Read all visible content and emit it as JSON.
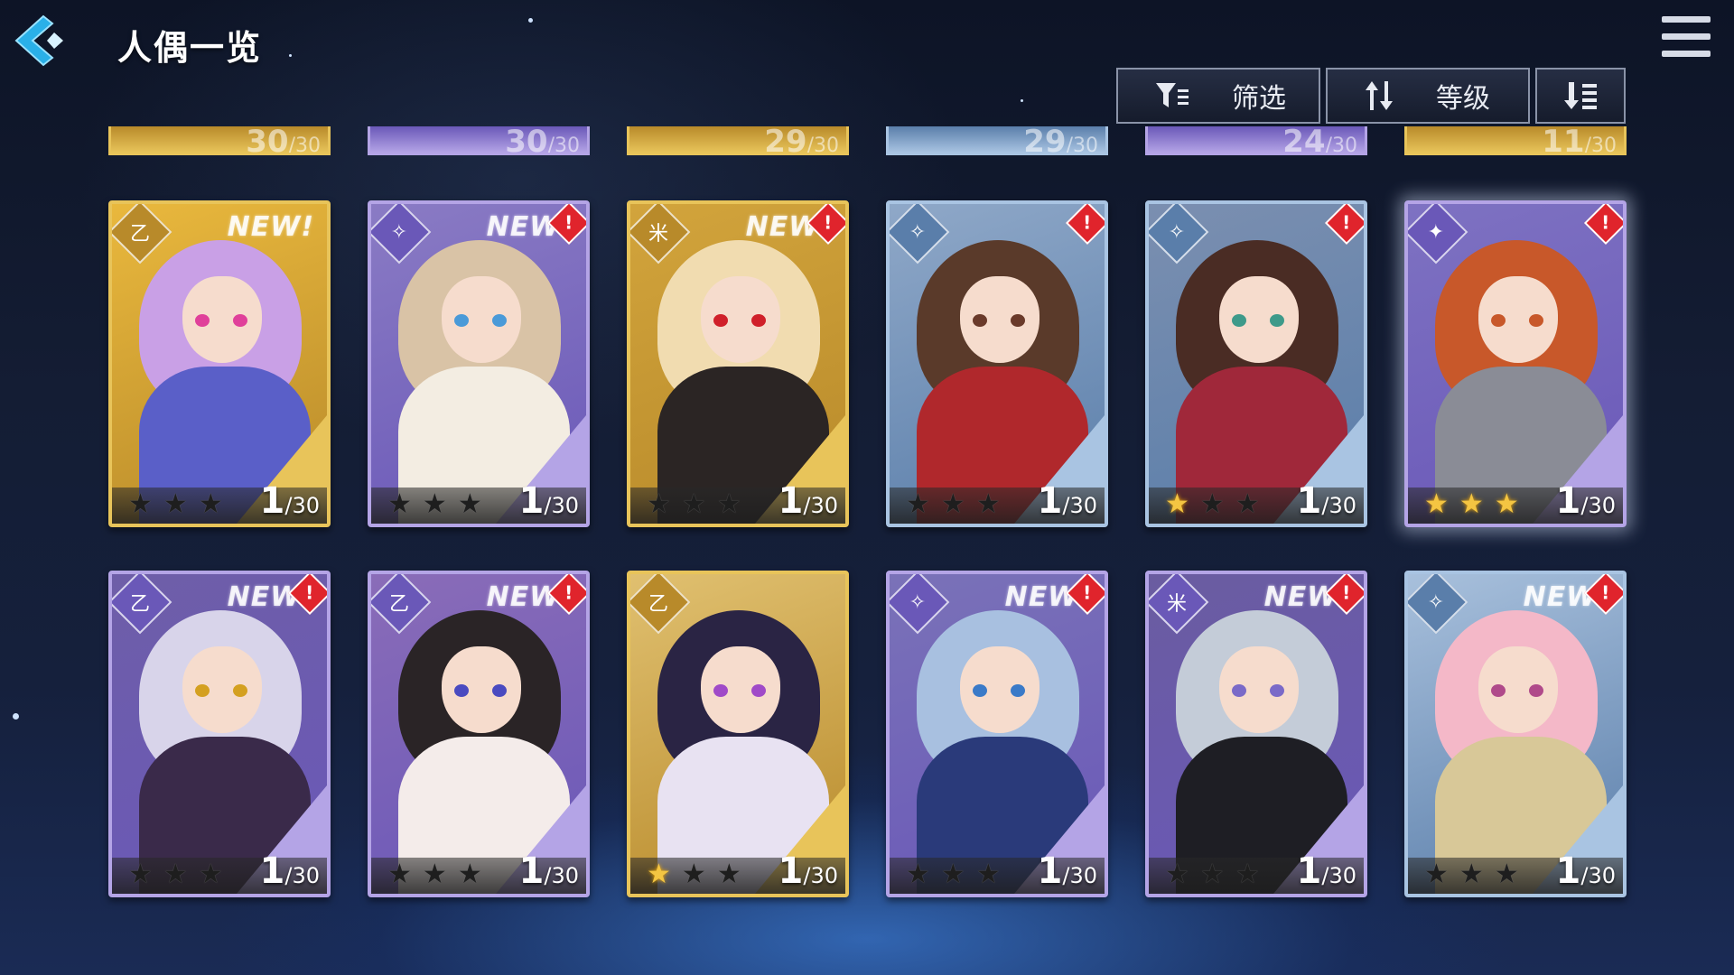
{
  "header": {
    "title": "人偶一览",
    "back_icon": "back-chevron-icon",
    "menu_icon": "hamburger-menu-icon"
  },
  "toolbar": {
    "filter_label": "筛选",
    "filter_icon": "filter-icon",
    "sort_label": "等级",
    "sort_icon": "sort-arrows-icon",
    "order_icon": "sort-order-icon"
  },
  "partial_row": [
    {
      "level": "30",
      "max": "/30",
      "frame": "gold"
    },
    {
      "level": "30",
      "max": "/30",
      "frame": "purple"
    },
    {
      "level": "29",
      "max": "/30",
      "frame": "gold"
    },
    {
      "level": "29",
      "max": "/30",
      "frame": "blue"
    },
    {
      "level": "24",
      "max": "/30",
      "frame": "purple"
    },
    {
      "level": "11",
      "max": "/30",
      "frame": "gold"
    }
  ],
  "cards": [
    {
      "frame": "gold",
      "attribute": "乙",
      "new": "NEW!",
      "alert": "",
      "stars_lit": 0,
      "level": "1",
      "max": "/30",
      "hair": "#c9a0e6",
      "outfit": "#5a5fc8",
      "eyes": "#e0409a",
      "bg": "#e9b83d"
    },
    {
      "frame": "purple",
      "attribute": "✧",
      "new": "NEW!",
      "alert": "!",
      "stars_lit": 0,
      "level": "1",
      "max": "/30",
      "hair": "#d9c3a6",
      "outfit": "#f3ede2",
      "eyes": "#4a9ad8",
      "bg": "#8a7bc4"
    },
    {
      "frame": "gold",
      "attribute": "米",
      "new": "NEW!",
      "alert": "!",
      "stars_lit": 0,
      "level": "1",
      "max": "/30",
      "hair": "#f1dcb0",
      "outfit": "#2b2524",
      "eyes": "#d0202a",
      "bg": "#d2a43c"
    },
    {
      "frame": "blue",
      "attribute": "✧",
      "new": "",
      "alert": "!",
      "stars_lit": 0,
      "level": "1",
      "max": "/30",
      "hair": "#5a3a2a",
      "outfit": "#b0282c",
      "eyes": "#6a3a2a",
      "bg": "#8fa8c8"
    },
    {
      "frame": "blue",
      "attribute": "✧",
      "new": "",
      "alert": "!",
      "stars_lit": 1,
      "level": "1",
      "max": "/30",
      "hair": "#4a2c24",
      "outfit": "#a0283a",
      "eyes": "#3e9a8a",
      "bg": "#7b8fb0"
    },
    {
      "frame": "purple",
      "attribute": "✦",
      "new": "",
      "alert": "!",
      "stars_lit": 3,
      "level": "1",
      "max": "/30",
      "hair": "#c8582a",
      "outfit": "#8a8c96",
      "eyes": "#c8582a",
      "bg": "#7e72c2"
    },
    {
      "frame": "purple",
      "attribute": "乙",
      "new": "NEW!",
      "alert": "!",
      "stars_lit": 0,
      "level": "1",
      "max": "/30",
      "hair": "#d8d4ea",
      "outfit": "#3a2a4a",
      "eyes": "#d4a020",
      "bg": "#6e5ea8"
    },
    {
      "frame": "purple",
      "attribute": "乙",
      "new": "NEW!",
      "alert": "!",
      "stars_lit": 0,
      "level": "1",
      "max": "/30",
      "hair": "#2a2426",
      "outfit": "#f4ecea",
      "eyes": "#4a4ac0",
      "bg": "#8a6cb8"
    },
    {
      "frame": "gold",
      "attribute": "乙",
      "new": "",
      "alert": "",
      "stars_lit": 1,
      "level": "1",
      "max": "/30",
      "hair": "#2a2444",
      "outfit": "#e8e2f2",
      "eyes": "#a04ac8",
      "bg": "#e0c070"
    },
    {
      "frame": "purple",
      "attribute": "✧",
      "new": "NEW!",
      "alert": "!",
      "stars_lit": 0,
      "level": "1",
      "max": "/30",
      "hair": "#a8c0e0",
      "outfit": "#2a3a7a",
      "eyes": "#3a7ac8",
      "bg": "#7a72b8"
    },
    {
      "frame": "purple",
      "attribute": "米",
      "new": "NEW!",
      "alert": "!",
      "stars_lit": 0,
      "level": "1",
      "max": "/30",
      "hair": "#c4ccd8",
      "outfit": "#1e1e24",
      "eyes": "#7a6ac8",
      "bg": "#6a5ca0"
    },
    {
      "frame": "blue",
      "attribute": "✧",
      "new": "NEW!",
      "alert": "!",
      "stars_lit": 0,
      "level": "1",
      "max": "/30",
      "hair": "#f4b8c8",
      "outfit": "#d8c898",
      "eyes": "#b04a8a",
      "bg": "#a8c0dc"
    }
  ],
  "colors": {
    "gold_frame": "#e8c45a",
    "purple_frame": "#b4a4e6",
    "blue_frame": "#a9c4e2",
    "alert_red": "#e0242c",
    "star_lit": "#f4c542"
  }
}
